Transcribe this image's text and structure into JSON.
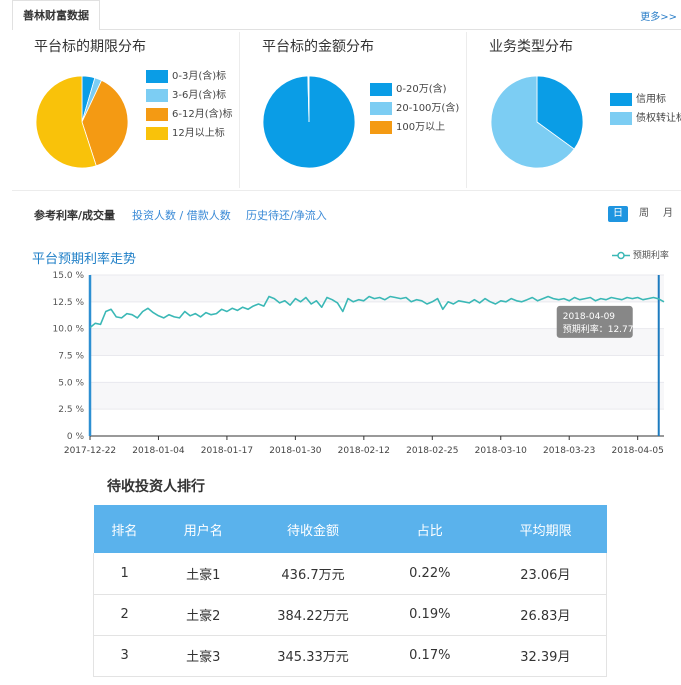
{
  "header": {
    "tab_label": "善林财富数据",
    "more_label": "更多>>"
  },
  "colors": {
    "blue_dark": "#0a9de6",
    "blue_light": "#7ccdf3",
    "orange": "#f49a13",
    "yellow": "#f9c20a",
    "teal_line": "#3bb8b6",
    "accent": "#1f95e0",
    "table_header": "#5ab2ec"
  },
  "pies": [
    {
      "title": "平台标的期限分布",
      "slices": [
        {
          "label": "0-3月(含)标",
          "value": 4.5,
          "color": "#0a9de6"
        },
        {
          "label": "3-6月(含)标",
          "value": 2.5,
          "color": "#7ccdf3"
        },
        {
          "label": "6-12月(含)标",
          "value": 38,
          "color": "#f49a13"
        },
        {
          "label": "12月以上标",
          "value": 55,
          "color": "#f9c20a"
        }
      ]
    },
    {
      "title": "平台标的金额分布",
      "slices": [
        {
          "label": "0-20万(含)",
          "value": 99.6,
          "color": "#0a9de6"
        },
        {
          "label": "20-100万(含)",
          "value": 0.3,
          "color": "#7ccdf3"
        },
        {
          "label": "100万以上",
          "value": 0.1,
          "color": "#f49a13"
        }
      ]
    },
    {
      "title": "业务类型分布",
      "slices": [
        {
          "label": "信用标",
          "value": 35,
          "color": "#0a9de6"
        },
        {
          "label": "债权转让标",
          "value": 65,
          "color": "#7ccdf3"
        }
      ]
    }
  ],
  "tabs": {
    "items": [
      {
        "label": "参考利率/成交量",
        "active": true
      },
      {
        "label": "投资人数 / 借款人数",
        "active": false
      },
      {
        "label": "历史待还/净流入",
        "active": false
      }
    ],
    "periods": [
      {
        "label": "日",
        "active": true
      },
      {
        "label": "周",
        "active": false
      },
      {
        "label": "月",
        "active": false
      }
    ]
  },
  "chart_data": {
    "type": "line",
    "title": "平台预期利率走势",
    "legend": "预期利率",
    "y_ticks": [
      "0 %",
      "2.5 %",
      "5.0 %",
      "7.5 %",
      "10.0 %",
      "12.5 %",
      "15.0 %"
    ],
    "ylim": [
      0,
      15
    ],
    "x_labels": [
      "2017-12-22",
      "2018-01-04",
      "2018-01-17",
      "2018-01-30",
      "2018-02-12",
      "2018-02-25",
      "2018-03-10",
      "2018-03-23",
      "2018-04-05"
    ],
    "tooltip": {
      "date": "2018-04-09",
      "text": "预期利率：12.77"
    },
    "x": [
      "2017-12-22",
      "2017-12-23",
      "2017-12-24",
      "2017-12-25",
      "2017-12-26",
      "2017-12-27",
      "2017-12-28",
      "2017-12-29",
      "2017-12-30",
      "2017-12-31",
      "2018-01-01",
      "2018-01-02",
      "2018-01-03",
      "2018-01-04",
      "2018-01-05",
      "2018-01-06",
      "2018-01-07",
      "2018-01-08",
      "2018-01-09",
      "2018-01-10",
      "2018-01-11",
      "2018-01-12",
      "2018-01-13",
      "2018-01-14",
      "2018-01-15",
      "2018-01-16",
      "2018-01-17",
      "2018-01-18",
      "2018-01-19",
      "2018-01-20",
      "2018-01-21",
      "2018-01-22",
      "2018-01-23",
      "2018-01-24",
      "2018-01-25",
      "2018-01-26",
      "2018-01-27",
      "2018-01-28",
      "2018-01-29",
      "2018-01-30",
      "2018-01-31",
      "2018-02-01",
      "2018-02-02",
      "2018-02-03",
      "2018-02-04",
      "2018-02-05",
      "2018-02-06",
      "2018-02-07",
      "2018-02-08",
      "2018-02-09",
      "2018-02-10",
      "2018-02-11",
      "2018-02-12",
      "2018-02-13",
      "2018-02-14",
      "2018-02-15",
      "2018-02-16",
      "2018-02-17",
      "2018-02-18",
      "2018-02-19",
      "2018-02-20",
      "2018-02-21",
      "2018-02-22",
      "2018-02-23",
      "2018-02-24",
      "2018-02-25",
      "2018-02-26",
      "2018-02-27",
      "2018-02-28",
      "2018-03-01",
      "2018-03-02",
      "2018-03-03",
      "2018-03-04",
      "2018-03-05",
      "2018-03-06",
      "2018-03-07",
      "2018-03-08",
      "2018-03-09",
      "2018-03-10",
      "2018-03-11",
      "2018-03-12",
      "2018-03-13",
      "2018-03-14",
      "2018-03-15",
      "2018-03-16",
      "2018-03-17",
      "2018-03-18",
      "2018-03-19",
      "2018-03-20",
      "2018-03-21",
      "2018-03-22",
      "2018-03-23",
      "2018-03-24",
      "2018-03-25",
      "2018-03-26",
      "2018-03-27",
      "2018-03-28",
      "2018-03-29",
      "2018-03-30",
      "2018-03-31",
      "2018-04-01",
      "2018-04-02",
      "2018-04-03",
      "2018-04-04",
      "2018-04-05",
      "2018-04-06",
      "2018-04-07",
      "2018-04-08",
      "2018-04-09",
      "2018-04-10"
    ],
    "values": [
      10.1,
      10.5,
      10.4,
      11.6,
      11.8,
      11.1,
      11.0,
      11.4,
      11.3,
      11.0,
      11.6,
      11.9,
      11.5,
      11.2,
      11.0,
      11.3,
      11.1,
      11.0,
      11.6,
      11.2,
      11.4,
      11.1,
      11.5,
      11.3,
      11.4,
      11.8,
      11.6,
      11.9,
      11.7,
      12.0,
      11.8,
      12.1,
      12.3,
      12.1,
      13.0,
      12.8,
      12.4,
      12.6,
      12.2,
      12.8,
      12.5,
      12.9,
      12.3,
      12.6,
      12.0,
      12.9,
      12.7,
      12.4,
      11.6,
      12.8,
      12.5,
      12.7,
      12.6,
      13.0,
      12.8,
      12.9,
      12.7,
      13.0,
      12.9,
      12.8,
      12.9,
      12.5,
      12.7,
      12.6,
      12.3,
      12.5,
      12.8,
      11.8,
      12.5,
      12.3,
      12.6,
      12.5,
      12.4,
      12.7,
      12.4,
      12.8,
      12.5,
      12.3,
      12.6,
      12.5,
      12.8,
      12.6,
      12.5,
      12.7,
      12.9,
      12.6,
      12.8,
      13.0,
      12.8,
      12.7,
      12.8,
      12.6,
      12.9,
      12.7,
      12.8,
      12.9,
      12.6,
      12.8,
      12.7,
      12.9,
      12.8,
      12.7,
      12.9,
      12.8,
      12.9,
      12.7,
      12.8,
      12.9,
      12.77,
      12.5
    ]
  },
  "ranking": {
    "title": "待收投资人排行",
    "columns": [
      "排名",
      "用户名",
      "待收金额",
      "占比",
      "平均期限"
    ],
    "rows": [
      [
        "1",
        "土豪1",
        "436.7万元",
        "0.22%",
        "23.06月"
      ],
      [
        "2",
        "土豪2",
        "384.22万元",
        "0.19%",
        "26.83月"
      ],
      [
        "3",
        "土豪3",
        "345.33万元",
        "0.17%",
        "32.39月"
      ]
    ]
  }
}
